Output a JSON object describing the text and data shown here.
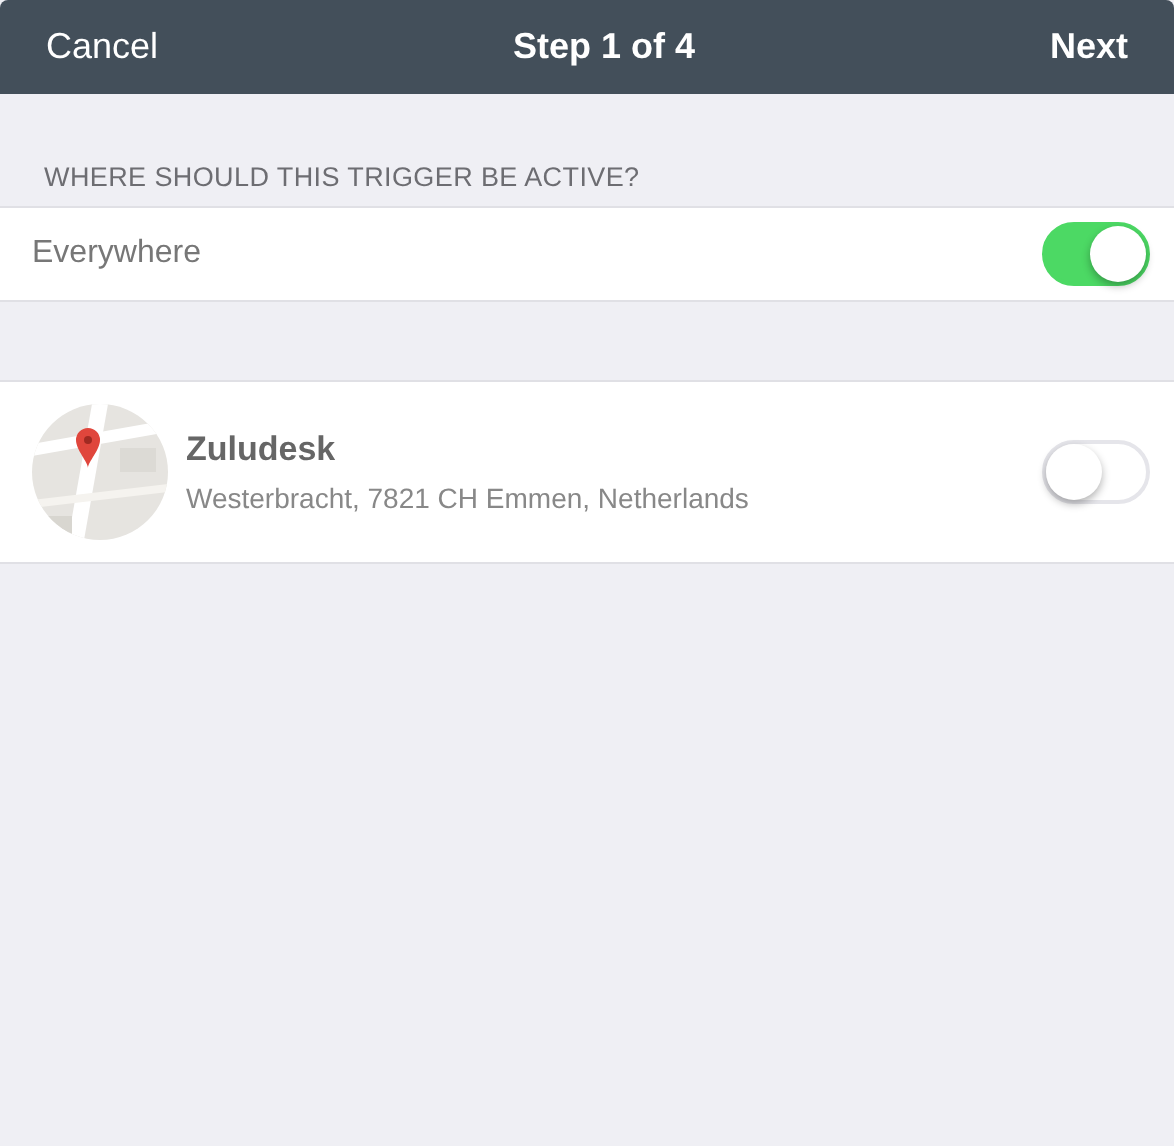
{
  "nav_bar": {
    "left_button": "Cancel",
    "title": "Step 1 of 4",
    "right_button": "Next"
  },
  "section_header": "WHERE SHOULD THIS TRIGGER BE ACTIVE?",
  "everywhere": {
    "label": "Everywhere",
    "on": true
  },
  "locations": [
    {
      "name": "Zuludesk",
      "address": "Westerbracht, 7821 CH Emmen, Netherlands",
      "on": false
    }
  ]
}
